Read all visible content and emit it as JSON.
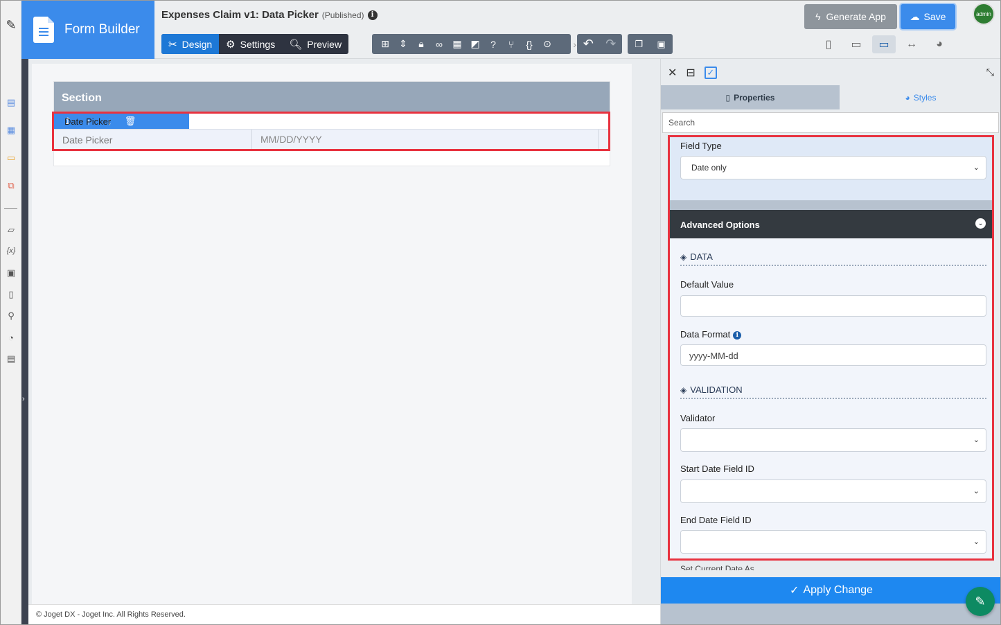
{
  "header": {
    "app_title": "Form Builder",
    "form_title": "Expenses Claim v1: Data Picker",
    "form_status": "(Published)",
    "tabs": [
      {
        "label": "Design",
        "icon": "design-icon"
      },
      {
        "label": "Settings",
        "icon": "gear-icon"
      },
      {
        "label": "Preview",
        "icon": "preview-icon"
      }
    ],
    "generate_label": "Generate App",
    "save_label": "Save",
    "avatar_text": "admin"
  },
  "canvas": {
    "section_title": "Section",
    "element_bar_label": "Date Picker",
    "field_label": "Date Picker",
    "field_placeholder": "MM/DD/YYYY"
  },
  "footer": {
    "copyright": "© Joget DX - Joget Inc. All Rights Reserved."
  },
  "panel": {
    "tab_properties": "Properties",
    "tab_styles": "Styles",
    "search_placeholder": "Search",
    "field_type_label": "Field Type",
    "field_type_value": "Date only",
    "advanced_options": "Advanced Options",
    "group_data": "DATA",
    "default_value_label": "Default Value",
    "default_value": "",
    "data_format_label": "Data Format",
    "data_format_value": "yyyy-MM-dd",
    "group_validation": "VALIDATION",
    "validator_label": "Validator",
    "start_date_label": "Start Date Field ID",
    "end_date_label": "End Date Field ID",
    "set_current_label": "Set Current Date As",
    "apply_label": "Apply Change"
  },
  "colors": {
    "brand_blue": "#3b8beb",
    "highlight_red": "#e8323f",
    "dark_header": "#343a40",
    "apply_blue": "#1e88f0",
    "fab_green": "#0d8a62"
  }
}
